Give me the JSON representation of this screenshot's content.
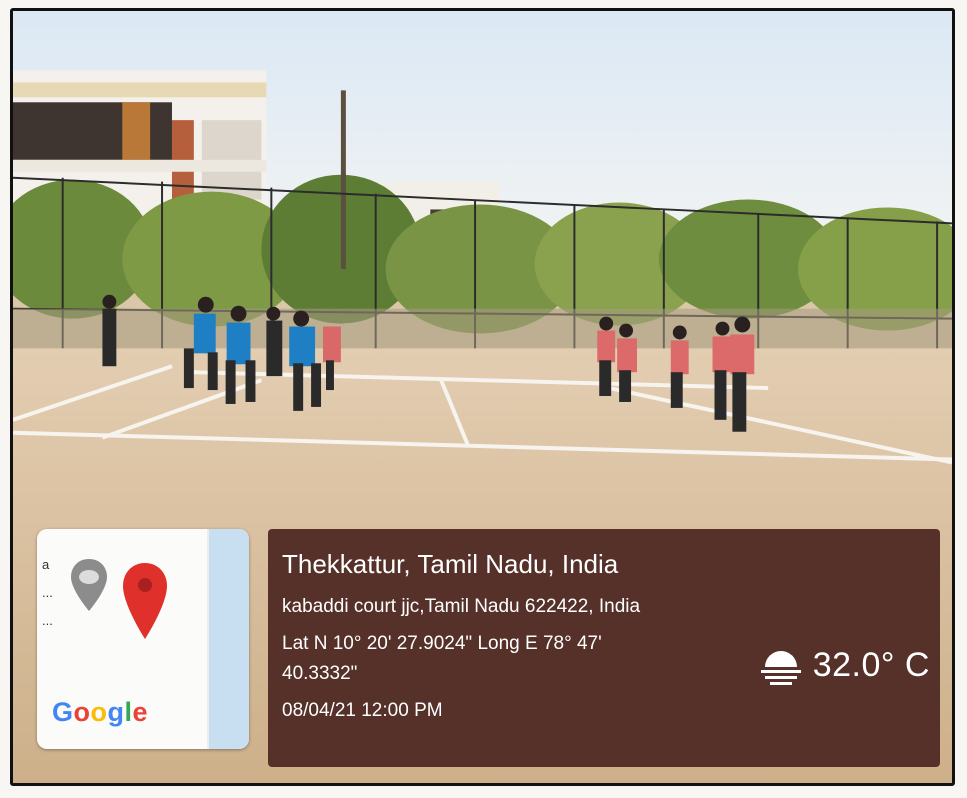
{
  "map": {
    "fragment_text": "a\n...\n...",
    "google_logo": [
      {
        "ch": "G",
        "color": "#4285F4"
      },
      {
        "ch": "o",
        "color": "#EA4335"
      },
      {
        "ch": "o",
        "color": "#FBBC05"
      },
      {
        "ch": "g",
        "color": "#4285F4"
      },
      {
        "ch": "l",
        "color": "#34A853"
      },
      {
        "ch": "e",
        "color": "#EA4335"
      }
    ],
    "icons": [
      "gray-map-pin-icon",
      "red-map-pin-icon"
    ],
    "water_color": "#c7dff1"
  },
  "info": {
    "place": "Thekkattur, Tamil Nadu, India",
    "address": "kabaddi court jjc,Tamil Nadu 622422, India",
    "coords_line1": "Lat N 10° 20' 27.9024\" Long E 78° 47'",
    "coords_line2": "40.3332\"",
    "datetime": "08/04/21 12:00 PM",
    "temperature": "32.0° C",
    "weather_icon": "sunset-weather-icon",
    "background_color": "#563129"
  },
  "colors": {
    "team_blue": "#1f7fc4",
    "team_red": "#dc6a6a",
    "ground": "#d6bea0"
  }
}
